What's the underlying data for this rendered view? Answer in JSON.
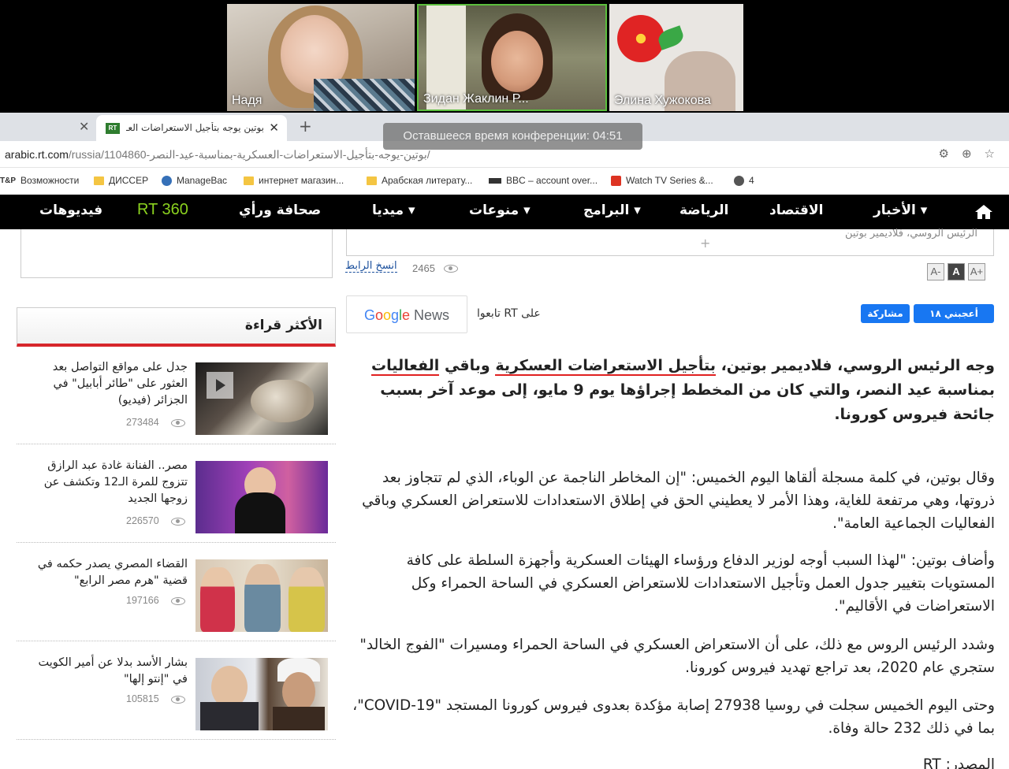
{
  "conference": {
    "participants": [
      {
        "name": "Надя"
      },
      {
        "name": "Зидан Жаклин Р..."
      },
      {
        "name": "Элина Хужокова"
      }
    ],
    "timer": "Оставшееся время конференции: 04:51"
  },
  "browser": {
    "tab_title": "بوتين يوجه بتأجيل الاستعراضات العـ",
    "tab_favicon": "RT",
    "url_domain": "arabic.rt.com",
    "url_path": "/russia/1104860-بوتين-يوجه-بتأجيل-الاستعراضات-العسكرية-بمناسبة-عيد-النصر/",
    "bookmarks": [
      {
        "label": "Возможности",
        "icon": "tap-icon"
      },
      {
        "label": "ДИССЕР",
        "icon": "folder-icon"
      },
      {
        "label": "ManageBac",
        "icon": "globe-icon"
      },
      {
        "label": "интернет магазин...",
        "icon": "folder-icon"
      },
      {
        "label": "Арабская литерату...",
        "icon": "folder-icon"
      },
      {
        "label": "BBC – account over...",
        "icon": "bbc-icon"
      },
      {
        "label": "Watch TV Series &...",
        "icon": "play-icon"
      },
      {
        "label": "4",
        "icon": "site-icon"
      }
    ],
    "tap_prefix": "T&P"
  },
  "nav": {
    "items": [
      "الأخبار ▾",
      "الاقتصاد",
      "الرياضة",
      "البرامج ▾",
      "منوعات ▾",
      "ميديا ▾",
      "صحافة ورأي",
      "RT 360",
      "فيديوهات"
    ]
  },
  "article": {
    "image_caption": "الرئيس الروسي، فلاديمير بوتين",
    "copy_link": "انسخ الرابط",
    "views": "2465",
    "font_buttons": [
      "A-",
      "A",
      "A+"
    ],
    "google_news": {
      "g1": "G",
      "g2": "o",
      "g3": "o",
      "g4": "g",
      "g5": "l",
      "g6": "e",
      "news": " News"
    },
    "follow_text": "تابعوا RT على",
    "like_label": "أعجبني ١٨",
    "share_label": "مشاركة",
    "lead_parts": [
      "وجه الرئيس الروسي، فلاديمير بوتين، ",
      "بتأجيل الاستعراضات العسكرية",
      " وباقي ",
      "الفعاليات",
      " بمناسبة عيد النصر، والتي كان من المخطط إجراؤها يوم 9 مايو، إلى موعد آخر بسبب جائحة فيروس كورونا."
    ],
    "paragraphs": [
      "وقال بوتين، في كلمة مسجلة ألقاها اليوم الخميس: \"إن المخاطر الناجمة عن الوباء، الذي لم تتجاوز بعد ذروتها، وهي مرتفعة للغاية، وهذا الأمر لا يعطيني الحق في إطلاق الاستعدادات للاستعراض العسكري وباقي الفعاليات الجماعية العامة\".",
      "وأضاف بوتين: \"لهذا السبب أوجه لوزير الدفاع ورؤساء الهيئات العسكرية وأجهزة السلطة على كافة المستويات بتغيير جدول العمل وتأجيل الاستعدادات للاستعراض العسكري في الساحة الحمراء وكل الاستعراضات في الأقاليم\".",
      "وشدد الرئيس الروس مع ذلك، على أن الاستعراض العسكري في الساحة الحمراء ومسيرات \"الفوج الخالد\" ستجري عام 2020، بعد تراجع تهديد فيروس كورونا.",
      "وحتى اليوم الخميس سجلت في روسيا 27938 إصابة مؤكدة بعدوى فيروس كورونا المستجد \"COVID-19\"، بما في ذلك 232 حالة وفاة.",
      "المصدر: RT"
    ]
  },
  "most_read": {
    "title": "الأكثر قراءة",
    "items": [
      {
        "text": "جدل على مواقع التواصل بعد العثور على \"طائر أبابيل\" في الجزائر (فيديو)",
        "views": "273484"
      },
      {
        "text": "مصر.. الفنانة غادة عبد الرازق تتزوج للمرة الـ12 وتكشف عن زوجها الجديد",
        "views": "226570"
      },
      {
        "text": "القضاء المصري يصدر حكمه في قضية \"هرم مصر الرابع\"",
        "views": "197166"
      },
      {
        "text": "بشار الأسد بدلا عن أمير الكويت في \"إنتو إلها\"",
        "views": "105815"
      }
    ]
  },
  "colors": {
    "accent_red": "#d7262b",
    "rt_green": "#8bd21f",
    "facebook_blue": "#1877f2"
  }
}
